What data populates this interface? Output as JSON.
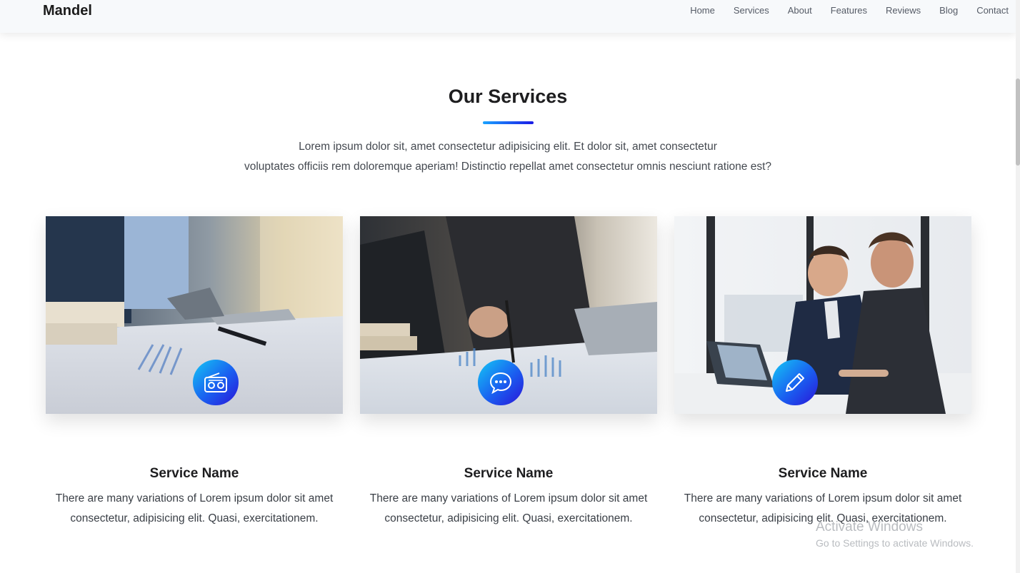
{
  "header": {
    "brand": "Mandel",
    "nav": [
      "Home",
      "Services",
      "About",
      "Features",
      "Reviews",
      "Blog",
      "Contact"
    ]
  },
  "section": {
    "title": "Our Services",
    "description_lines": [
      "Lorem ipsum dolor sit, amet consectetur adipisicing elit. Et dolor sit, amet consectetur",
      "voluptates officiis rem doloremque aperiam! Distinctio repellat amet consectetur omnis nesciunt ratione est?"
    ]
  },
  "cards": [
    {
      "icon": "radio-icon",
      "title": "Service Name",
      "text": "There are many variations of Lorem ipsum dolor sit amet consectetur, adipisicing elit. Quasi, exercitationem."
    },
    {
      "icon": "chat-icon",
      "title": "Service Name",
      "text": "There are many variations of Lorem ipsum dolor sit amet consectetur, adipisicing elit. Quasi, exercitationem."
    },
    {
      "icon": "pencil-icon",
      "title": "Service Name",
      "text": "There are many variations of Lorem ipsum dolor sit amet consectetur, adipisicing elit. Quasi, exercitationem."
    }
  ],
  "watermark": {
    "title": "Activate Windows",
    "subtitle": "Go to Settings to activate Windows."
  },
  "colors": {
    "accent_start": "#14c8f5",
    "accent_end": "#2a14d8"
  }
}
